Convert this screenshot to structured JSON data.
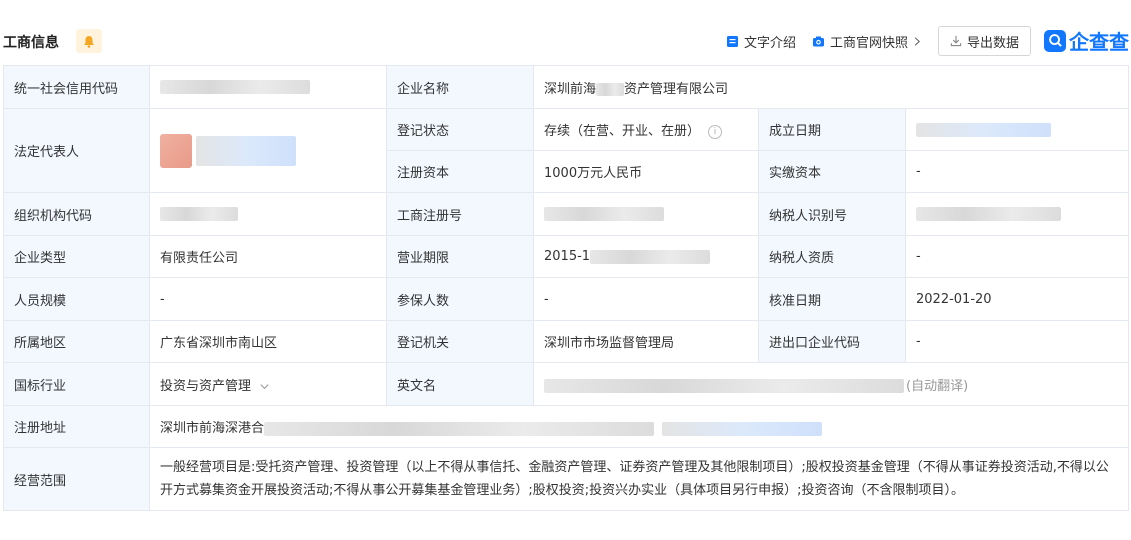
{
  "header": {
    "title": "工商信息",
    "text_intro": "文字介绍",
    "snapshot": "工商官网快照",
    "export": "导出数据",
    "brand": "企查查"
  },
  "rows": {
    "credit_code_label": "统一社会信用代码",
    "company_name_label": "企业名称",
    "company_name_prefix": "深圳前海",
    "company_name_suffix": "资产管理有限公司",
    "legal_rep_label": "法定代表人",
    "reg_status_label": "登记状态",
    "reg_status_value": "存续（在营、开业、在册）",
    "found_date_label": "成立日期",
    "reg_capital_label": "注册资本",
    "reg_capital_value": "1000万元人民币",
    "paid_capital_label": "实缴资本",
    "paid_capital_value": "-",
    "org_code_label": "组织机构代码",
    "biz_reg_no_label": "工商注册号",
    "taxpayer_id_label": "纳税人识别号",
    "company_type_label": "企业类型",
    "company_type_value": "有限责任公司",
    "biz_term_label": "营业期限",
    "biz_term_value": "2015-1",
    "taxpayer_qual_label": "纳税人资质",
    "taxpayer_qual_value": "-",
    "staff_size_label": "人员规模",
    "staff_size_value": "-",
    "insured_label": "参保人数",
    "insured_value": "-",
    "approval_date_label": "核准日期",
    "approval_date_value": "2022-01-20",
    "region_label": "所属地区",
    "region_value": "广东省深圳市南山区",
    "reg_authority_label": "登记机关",
    "reg_authority_value": "深圳市市场监督管理局",
    "import_export_label": "进出口企业代码",
    "import_export_value": "-",
    "industry_label": "国标行业",
    "industry_value": "投资与资产管理",
    "english_name_label": "英文名",
    "english_name_suffix": "(自动翻译)",
    "address_label": "注册地址",
    "address_value": "深圳市前海深港合",
    "scope_label": "经营范围",
    "scope_value": "一般经营项目是:受托资产管理、投资管理（以上不得从事信托、金融资产管理、证券资产管理及其他限制项目）;股权投资基金管理（不得从事证券投资活动,不得以公开方式募集资金开展投资活动;不得从事公开募集基金管理业务）;股权投资;投资兴办实业（具体项目另行申报）;投资咨询（不含限制项目）。"
  },
  "colors": {
    "label_bg": "#f2f8fe",
    "border": "#e4e8ef",
    "accent": "#1277ff",
    "bell": "#f5a623"
  }
}
